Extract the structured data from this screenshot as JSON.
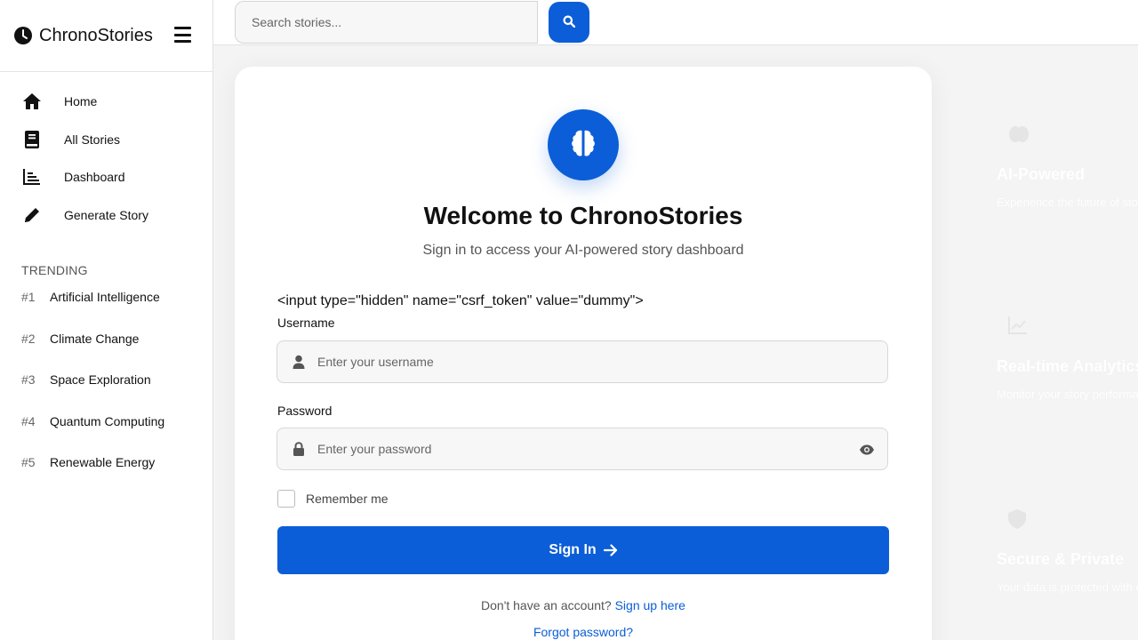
{
  "brand": {
    "name": "ChronoStories"
  },
  "search": {
    "placeholder": "Search stories..."
  },
  "nav": {
    "items": [
      {
        "label": "Home",
        "icon": "home-icon"
      },
      {
        "label": "All Stories",
        "icon": "book-icon"
      },
      {
        "label": "Dashboard",
        "icon": "chart-icon"
      },
      {
        "label": "Generate Story",
        "icon": "pencil-icon"
      }
    ]
  },
  "trending": {
    "title": "TRENDING",
    "items": [
      {
        "rank": "#1",
        "label": "Artificial Intelligence"
      },
      {
        "rank": "#2",
        "label": "Climate Change"
      },
      {
        "rank": "#3",
        "label": "Space Exploration"
      },
      {
        "rank": "#4",
        "label": "Quantum Computing"
      },
      {
        "rank": "#5",
        "label": "Renewable Energy"
      }
    ]
  },
  "login": {
    "title": "Welcome to ChronoStories",
    "subtitle": "Sign in to access your AI-powered story dashboard",
    "raw_text": "<input type=\"hidden\" name=\"csrf_token\" value=\"dummy\">",
    "username_label": "Username",
    "username_placeholder": "Enter your username",
    "password_label": "Password",
    "password_placeholder": "Enter your password",
    "remember_label": "Remember me",
    "signin_label": "Sign In",
    "signup_prompt": "Don't have an account?",
    "signup_link": "Sign up here",
    "forgot_link": "Forgot password?"
  },
  "features": [
    {
      "title": "AI-Powered",
      "desc": "Experience the future of storytelling with autonomous AI story engines",
      "icon": "brain-icon"
    },
    {
      "title": "Real-time Analytics",
      "desc": "Monitor your story performance with real-time data",
      "icon": "chart-line-icon"
    },
    {
      "title": "Secure & Private",
      "desc": "Your data is protected with enterprise security measures",
      "icon": "shield-icon"
    }
  ],
  "colors": {
    "accent": "#0b5ed7",
    "sidebar_bg": "#ffffff",
    "page_bg": "#f4f4f5"
  }
}
